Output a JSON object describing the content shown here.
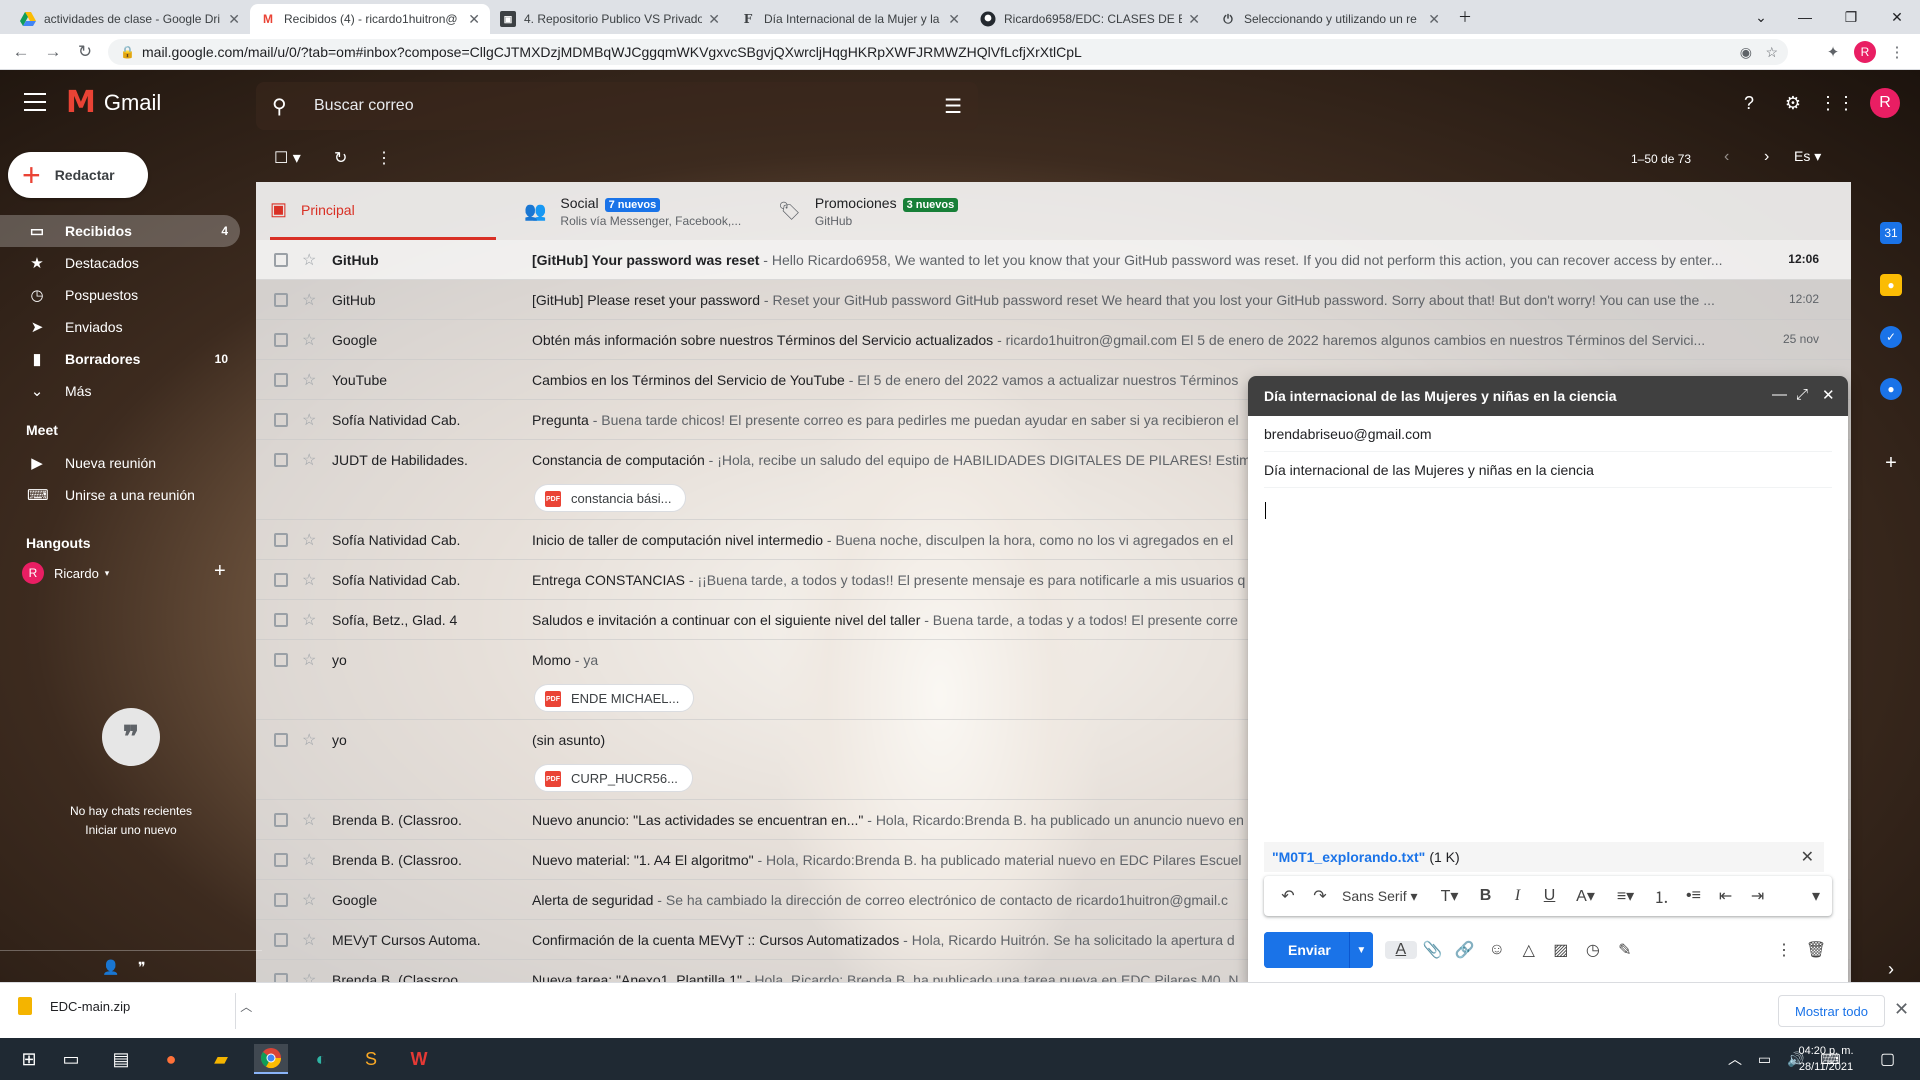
{
  "browser": {
    "tabs": [
      {
        "title": "actividades de clase - Google Dri",
        "icon": "google-drive-icon"
      },
      {
        "title": "Recibidos (4) - ricardo1huitron@",
        "icon": "gmail-icon"
      },
      {
        "title": "4. Repositorio Publico VS Privado",
        "icon": "classroom-icon"
      },
      {
        "title": "Día Internacional de la Mujer y la",
        "icon": "F"
      },
      {
        "title": "Ricardo6958/EDC: CLASES DE ES",
        "icon": "github-icon"
      },
      {
        "title": "Seleccionando y utilizando un re",
        "icon": "power-icon"
      }
    ],
    "url": "mail.google.com/mail/u/0/?tab=om#inbox?compose=CllgCJTMXDzjMDMBqWJCggqmWKVgxvcSBgvjQXwrcljHqgHKRpXWFJRMWZHQlVfLcfjXrXtlCpL",
    "profile_initial": "R"
  },
  "gmail": {
    "product_name": "Gmail",
    "search_placeholder": "Buscar correo",
    "compose_label": "Redactar",
    "nav": [
      {
        "label": "Recibidos",
        "count": "4",
        "icon": "inbox-icon"
      },
      {
        "label": "Destacados",
        "count": "",
        "icon": "star-icon"
      },
      {
        "label": "Pospuestos",
        "count": "",
        "icon": "clock-icon"
      },
      {
        "label": "Enviados",
        "count": "",
        "icon": "send-icon"
      },
      {
        "label": "Borradores",
        "count": "10",
        "icon": "draft-icon"
      },
      {
        "label": "Más",
        "count": "",
        "icon": "chevron-down-icon"
      }
    ],
    "meet_heading": "Meet",
    "meet_items": [
      {
        "label": "Nueva reunión",
        "icon": "video-icon"
      },
      {
        "label": "Unirse a una reunión",
        "icon": "keyboard-icon"
      }
    ],
    "hangouts_heading": "Hangouts",
    "hangouts_user": "Ricardo",
    "no_chats_line1": "No hay chats recientes",
    "no_chats_line2": "Iniciar uno nuevo",
    "pager": "1–50 de 73",
    "input_lang": "Es",
    "category_tabs": [
      {
        "label": "Principal",
        "badge": "",
        "sub": ""
      },
      {
        "label": "Social",
        "badge": "7 nuevos",
        "sub": "Rolis vía Messenger, Facebook,..."
      },
      {
        "label": "Promociones",
        "badge": "3 nuevos",
        "sub": "GitHub"
      }
    ],
    "emails": [
      {
        "from": "GitHub",
        "subject": "[GitHub] Your password was reset",
        "snippet": " - Hello Ricardo6958, We wanted to let you know that your GitHub password was reset. If you did not perform this action, you can recover access by enter...",
        "date": "12:06",
        "unread": true,
        "attachment": ""
      },
      {
        "from": "GitHub",
        "subject": "[GitHub] Please reset your password",
        "snippet": " - Reset your GitHub password GitHub password reset We heard that you lost your GitHub password. Sorry about that! But don't worry! You can use the ...",
        "date": "12:02",
        "unread": false,
        "attachment": ""
      },
      {
        "from": "Google",
        "subject": "Obtén más información sobre nuestros Términos del Servicio actualizados",
        "snippet": " - ricardo1huitron@gmail.com El 5 de enero de 2022 haremos algunos cambios en nuestros Términos del Servici...",
        "date": "25 nov",
        "unread": false,
        "attachment": ""
      },
      {
        "from": "YouTube",
        "subject": "Cambios en los Términos del Servicio de YouTube",
        "snippet": " - El 5 de enero del 2022 vamos a actualizar nuestros Términos",
        "date": "",
        "unread": false,
        "attachment": ""
      },
      {
        "from": "Sofía Natividad Cab.",
        "subject": "Pregunta",
        "snippet": " - Buena tarde chicos! El presente correo es para pedirles me puedan ayudar en saber si ya recibieron el",
        "date": "",
        "unread": false,
        "attachment": ""
      },
      {
        "from": "JUDT de Habilidades.",
        "subject": "Constancia de computación",
        "snippet": " - ¡Hola, recibe un saludo del equipo de HABILIDADES DIGITALES DE PILARES! Estima",
        "date": "",
        "unread": false,
        "attachment": "constancia bási..."
      },
      {
        "from": "Sofía Natividad Cab.",
        "subject": "Inicio de taller de computación nivel intermedio",
        "snippet": " - Buena noche, disculpen la hora, como no los vi agregados en el",
        "date": "",
        "unread": false,
        "attachment": ""
      },
      {
        "from": "Sofía Natividad Cab.",
        "subject": "Entrega CONSTANCIAS",
        "snippet": " - ¡¡Buena tarde, a todos y todas!! El presente mensaje es para notificarle a mis usuarios q",
        "date": "",
        "unread": false,
        "attachment": ""
      },
      {
        "from": "Sofía, Betz., Glad. 4",
        "subject": "Saludos e invitación a continuar con el siguiente nivel del taller",
        "snippet": " - Buena tarde, a todas y a todos! El presente corre",
        "date": "",
        "unread": false,
        "attachment": ""
      },
      {
        "from": "yo",
        "subject": "Momo",
        "snippet": " - ya",
        "date": "",
        "unread": false,
        "attachment": "ENDE MICHAEL..."
      },
      {
        "from": "yo",
        "subject": "(sin asunto)",
        "snippet": "",
        "date": "",
        "unread": false,
        "attachment": "CURP_HUCR56..."
      },
      {
        "from": "Brenda B. (Classroo.",
        "subject": "Nuevo anuncio: \"Las actividades se encuentran en...\"",
        "snippet": " - Hola, Ricardo:Brenda B. ha publicado un anuncio nuevo en",
        "date": "",
        "unread": false,
        "attachment": ""
      },
      {
        "from": "Brenda B. (Classroo.",
        "subject": "Nuevo material: \"1. A4 El algoritmo\"",
        "snippet": " - Hola, Ricardo:Brenda B. ha publicado material nuevo en EDC Pilares Escuel",
        "date": "",
        "unread": false,
        "attachment": ""
      },
      {
        "from": "Google",
        "subject": "Alerta de seguridad",
        "snippet": " - Se ha cambiado la dirección de correo electrónico de contacto de ricardo1huitron@gmail.c",
        "date": "",
        "unread": false,
        "attachment": ""
      },
      {
        "from": "MEVyT Cursos Automa.",
        "subject": "Confirmación de la cuenta MEVyT :: Cursos Automatizados",
        "snippet": " - Hola, Ricardo Huitrón. Se ha solicitado la apertura d",
        "date": "",
        "unread": false,
        "attachment": ""
      },
      {
        "from": "Brenda B. (Classroo.",
        "subject": "Nueva tarea: \"Anexo1_Plantilla 1\"",
        "snippet": " - Hola, Ricardo: Brenda B. ha publicado una tarea nueva en EDC Pilares M0. N",
        "date": "",
        "unread": false,
        "attachment": ""
      }
    ]
  },
  "compose": {
    "title": "Día internacional de las Mujeres y niñas en la ciencia",
    "to": "brendabriseuo@gmail.com",
    "subject": "Día internacional de las  Mujeres y niñas en la ciencia",
    "attachment_name": "\"M0T1_explorando.txt\"",
    "attachment_size": "(1 K)",
    "font_name": "Sans Serif",
    "send_label": "Enviar"
  },
  "downloads": {
    "file": "EDC-main.zip",
    "show_all": "Mostrar todo"
  },
  "taskbar": {
    "time": "04:20 p. m.",
    "date": "28/11/2021"
  },
  "colors": {
    "gmail_red": "#ea4335",
    "accent_blue": "#1a73e8",
    "social_badge": "#1a73e8",
    "promo_badge": "#188038"
  }
}
